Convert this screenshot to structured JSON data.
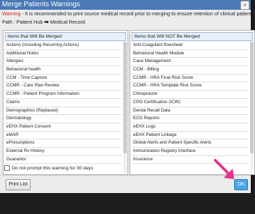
{
  "dialog": {
    "title": "Merge Patients Warnings",
    "close_glyph": "×",
    "warning_label": "Warning",
    "warning_text": " - It is recommended to print source medical record prior to merging to ensure retention of clinical patient data.",
    "path_prefix": "Path : Patient Hub ",
    "path_arrow": "➡",
    "path_target": " Medical Record"
  },
  "left_list": {
    "header": "Items that Will Be Merged",
    "items": [
      "Actions (Including Recurring Actions)",
      "Additional Notes",
      "Allergies",
      "Behavioral health",
      "CCM - Time Capture",
      "CCMR - Care Plan Review",
      "CCMR - Patient Program Information",
      "Claims",
      "Demographics (Replaced)",
      "Dermatology",
      "eEHX Patient Consent",
      "eMAR",
      "ePrescriptions",
      "External Rx History",
      "Guarantor"
    ]
  },
  "right_list": {
    "header": "Items that Will NOT Be Merged",
    "items": [
      "Anti-Coagulant flowsheet",
      "Behavioral Health Module",
      "Case Management",
      "CCM - Billing",
      "CCMR - HRA Final Risk Score",
      "CCMR - HRA Template Risk Score",
      "Chiropractor",
      "CPO Certification (ICW)",
      "Dental Recall Data",
      "ECG Reports",
      "eEHX Logs",
      "eEHX Patient Linkage",
      "Global Alerts and Patient Specific Alerts",
      "Immunization Registry Interface",
      "Insurance"
    ]
  },
  "checkbox": {
    "label": "Do not prompt this warning for 30 days",
    "checked": false
  },
  "footer": {
    "print_label": "Print List",
    "ok_label": "OK"
  },
  "colors": {
    "titlebar": "#4b79b8",
    "warning": "#d42020",
    "ok_button": "#49a6ea",
    "pointer": "#e8318a"
  },
  "icons": {
    "pointer": "arrow-pointer-icon"
  }
}
